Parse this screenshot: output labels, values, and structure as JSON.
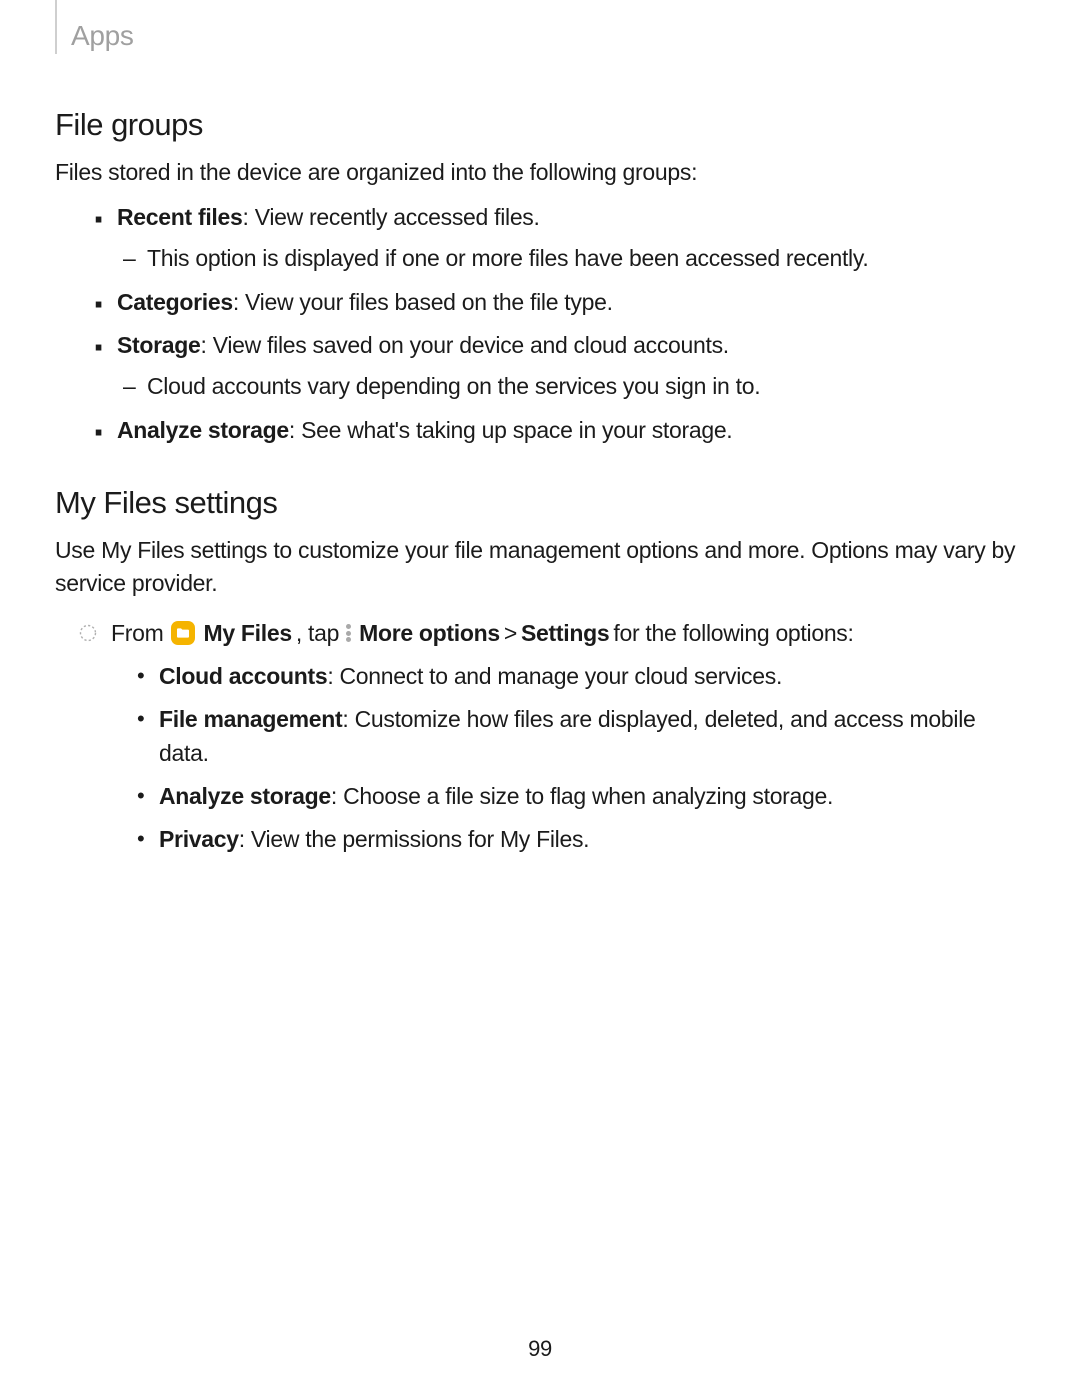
{
  "header": {
    "section": "Apps"
  },
  "fileGroups": {
    "heading": "File groups",
    "intro": "Files stored in the device are organized into the following groups:",
    "items": [
      {
        "label": "Recent files",
        "desc": ": View recently accessed files.",
        "sub": [
          "This option is displayed if one or more files have been accessed recently."
        ]
      },
      {
        "label": "Categories",
        "desc": ": View your files based on the file type."
      },
      {
        "label": "Storage",
        "desc": ": View files saved on your device and cloud accounts.",
        "sub": [
          "Cloud accounts vary depending on the services you sign in to."
        ]
      },
      {
        "label": "Analyze storage",
        "desc": ": See what's taking up space in your storage."
      }
    ]
  },
  "settings": {
    "heading": "My Files settings",
    "intro": "Use My Files settings to customize your file management options and more. Options may vary by service provider.",
    "fromLine": {
      "from": "From",
      "appName": "My Files",
      "tap": ", tap",
      "moreOptions": "More options",
      "sep": " > ",
      "settings": "Settings",
      "tail": " for the following options:"
    },
    "options": [
      {
        "label": "Cloud accounts",
        "desc": ": Connect to and manage your cloud services."
      },
      {
        "label": "File management",
        "desc": ": Customize how files are displayed, deleted, and access mobile data."
      },
      {
        "label": "Analyze storage",
        "desc": ": Choose a file size to flag when analyzing storage."
      },
      {
        "label": "Privacy",
        "desc": ": View the permissions for My Files."
      }
    ]
  },
  "pageNumber": "99"
}
